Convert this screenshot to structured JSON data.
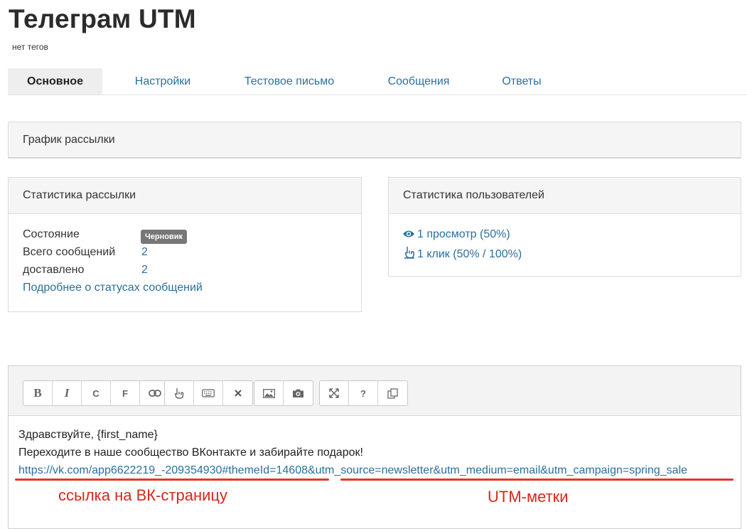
{
  "page": {
    "title": "Телеграм UTM",
    "tags": "нет тегов"
  },
  "tabs": [
    {
      "label": "Основное",
      "active": true
    },
    {
      "label": "Настройки"
    },
    {
      "label": "Тестовое письмо"
    },
    {
      "label": "Сообщения"
    },
    {
      "label": "Ответы"
    }
  ],
  "schedule": {
    "title": "График рассылки"
  },
  "stats": {
    "title": "Статистика рассылки",
    "status_label": "Состояние",
    "status_badge": "Черновик",
    "total_label": "Всего сообщений",
    "total_value": "2",
    "delivered_label": "доставлено",
    "delivered_value": "2",
    "details_link": "Подробнее о статусах сообщений"
  },
  "users": {
    "title": "Статистика пользователей",
    "views": "1 просмотр (50%)",
    "clicks": "1 клик (50% / 100%)",
    "views_icon": "eye-icon",
    "clicks_icon": "pointer-hand-icon"
  },
  "editor": {
    "toolbar": {
      "bold": "B",
      "italic": "I",
      "strike": "C",
      "mono": "F"
    },
    "content": {
      "line1": "Здравствуйте, {first_name}",
      "line2": "Переходите в наше сообщество ВКонтакте и забирайте подарок!",
      "url": "https://vk.com/app6622219_-209354930#themeId=14608&utm_source=newsletter&utm_medium=email&utm_campaign=spring_sale"
    }
  },
  "annotations": {
    "vk_link": "ссылка на ВК-страницу",
    "utm": "UTM-метки",
    "color": "#e0372b"
  },
  "colors": {
    "link": "#2a6f9e",
    "badge": "#777777",
    "active_tab": "#eeeeee"
  }
}
